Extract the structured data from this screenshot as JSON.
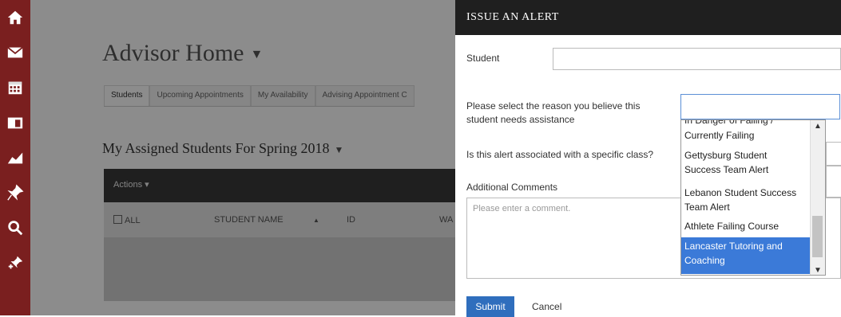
{
  "nav": {
    "items": [
      {
        "name": "home-icon"
      },
      {
        "name": "mail-icon"
      },
      {
        "name": "calendar-icon"
      },
      {
        "name": "folder-icon"
      },
      {
        "name": "chart-icon"
      },
      {
        "name": "pin-icon"
      },
      {
        "name": "search-icon"
      },
      {
        "name": "add-pin-icon"
      }
    ],
    "colors": {
      "rail": "#7a1f1f",
      "icon": "#ffffff"
    }
  },
  "page": {
    "title": "Advisor Home",
    "tabs": [
      "Students",
      "Upcoming Appointments",
      "My Availability",
      "Advising Appointment C"
    ],
    "section_title": "My Assigned Students For Spring 2018",
    "actions_label": "Actions",
    "columns": {
      "all": "ALL",
      "student_name": "STUDENT NAME",
      "id": "ID",
      "wat": "WA"
    }
  },
  "modal": {
    "title": "ISSUE AN ALERT",
    "student_label": "Student",
    "reason_label_line1": "Please select the reason you believe this",
    "reason_label_line2": "student needs assistance",
    "class_label": "Is this alert associated with a specific class?",
    "comments_label": "Additional Comments",
    "comments_placeholder": "Please enter a comment.",
    "options": [
      {
        "line1": "In Danger of Failing /",
        "line2": ""
      },
      {
        "line1": "Currently Failing",
        "line2": ""
      },
      {
        "line1": "Gettysburg Student",
        "line2": "Success Team Alert"
      },
      {
        "line1": "Lebanon Student Success",
        "line2": "Team Alert"
      },
      {
        "line1": "Athlete Failing Course",
        "line2": ""
      },
      {
        "line1": "Lancaster Tutoring and",
        "line2": "Coaching"
      }
    ],
    "selected_option": "Lancaster Tutoring and Coaching",
    "submit_label": "Submit",
    "cancel_label": "Cancel",
    "accent": "#3b7ad8"
  }
}
